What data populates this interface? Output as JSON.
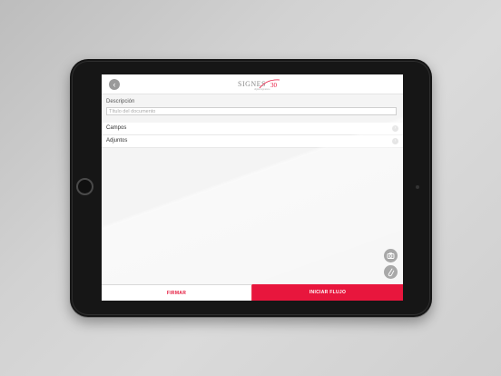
{
  "header": {
    "back_icon": "back-arrow-icon",
    "logo_text": "SIGNES",
    "logo_mark": "30",
    "logo_subtitle": "digital signature",
    "logo_accent_color": "#e8163d"
  },
  "form": {
    "description_label": "Descripción",
    "document_title_placeholder": "Título del documento",
    "document_title_value": ""
  },
  "sections": [
    {
      "label": "Campos",
      "icon": "chevron-right-icon"
    },
    {
      "label": "Adjuntos",
      "icon": "chevron-right-icon"
    }
  ],
  "actions": {
    "camera_icon": "camera-icon",
    "attach_icon": "paperclip-icon",
    "sign_label": "FIRMAR",
    "start_flow_label": "INICIAR FLUJO"
  },
  "colors": {
    "primary": "#e8163d",
    "icon_gray": "#a8a8a8"
  }
}
